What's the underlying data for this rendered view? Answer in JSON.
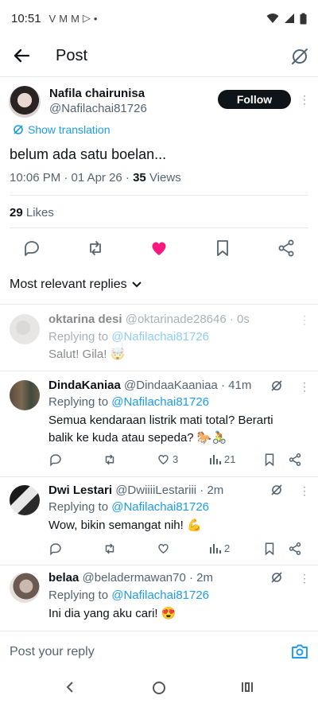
{
  "status_bar": {
    "time": "10:51",
    "notifications": [
      "V",
      "M",
      "M",
      "▷",
      "•"
    ]
  },
  "header": {
    "title": "Post"
  },
  "post": {
    "author": "Nafila chairunisa",
    "handle": "@Nafilachai81726",
    "follow_label": "Follow",
    "translate_label": "Show translation",
    "text": "belum ada satu boelan...",
    "time": "10:06 PM · 01 Apr 26 · ",
    "views_count": "35",
    "views_label": " Views",
    "likes_count": "29",
    "likes_label": " Likes"
  },
  "sort_label": "Most relevant replies",
  "replies": [
    {
      "name": "oktarina desi",
      "handle": "@oktarinade28646 · 0s",
      "replying_prefix": "Replying to ",
      "replying_to": "@Nafilachai81726",
      "text": "Salut! Gila! 🤯"
    },
    {
      "name": "DindaKaniaa",
      "handle": "@DindaaKaaniaa · 41m",
      "replying_prefix": "Replying to ",
      "replying_to": "@Nafilachai81726",
      "text": "Semua kendaraan listrik mati total? Berarti balik ke kuda atau sepeda? 🐎🚴",
      "likes": "3",
      "views": "21"
    },
    {
      "name": "Dwi Lestari",
      "handle": "@DwiiiiLestariii · 2m",
      "replying_prefix": "Replying to ",
      "replying_to": "@Nafilachai81726",
      "text": "Wow, bikin semangat nih! 💪",
      "views": "2"
    },
    {
      "name": "belaa",
      "handle": "@beladermawan70 · 2m",
      "replying_prefix": "Replying to ",
      "replying_to": "@Nafilachai81726",
      "text": "Ini dia yang aku cari! 😍"
    }
  ],
  "compose": {
    "placeholder": "Post your reply"
  },
  "colors": {
    "accent": "#1d9bf0",
    "like": "#f91880",
    "text": "#0f1419",
    "muted": "#536471"
  }
}
